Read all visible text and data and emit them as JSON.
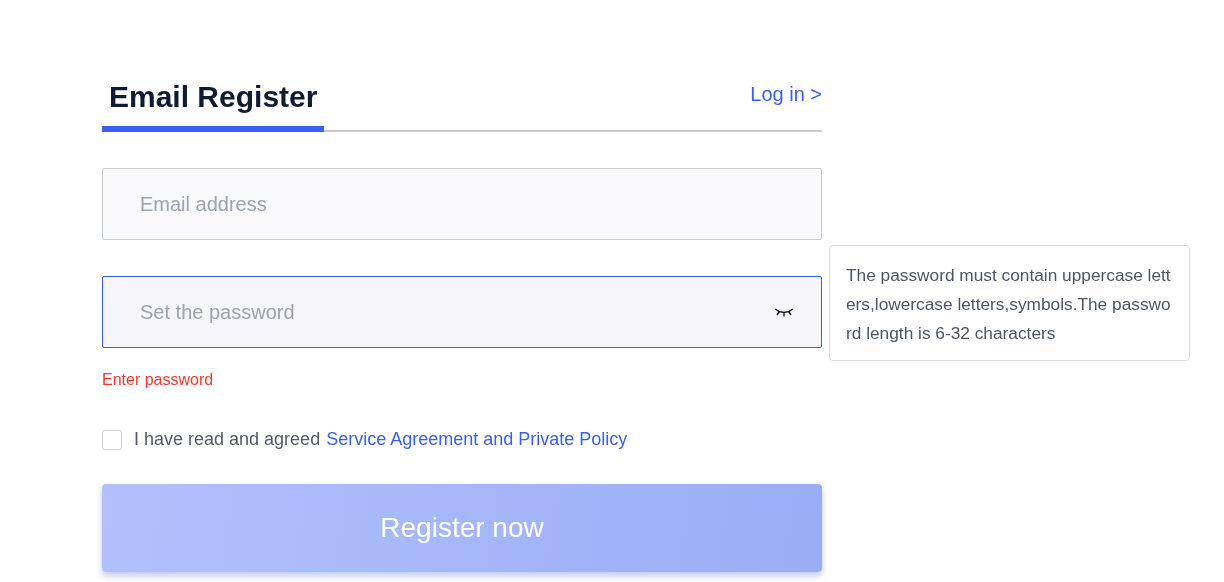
{
  "header": {
    "title": "Email Register",
    "login_link": "Log in >"
  },
  "fields": [
    {
      "kind": "email",
      "placeholder": "Email address",
      "focused": false
    },
    {
      "kind": "password",
      "placeholder": "Set the password",
      "focused": true,
      "error": "Enter password"
    }
  ],
  "agreement": {
    "checked": false,
    "text": "I have read and agreed",
    "link": "Service Agreement and Private Policy"
  },
  "submit": {
    "label": "Register now",
    "disabled": true
  },
  "tooltip": {
    "text": "The password must contain uppercase letters,lowercase letters,symbols.The password length is 6-32 characters"
  }
}
